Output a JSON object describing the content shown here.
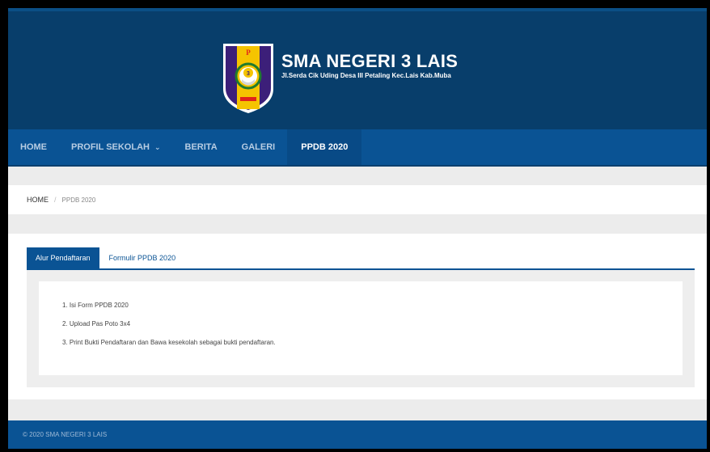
{
  "header": {
    "school_name": "SMA NEGERI 3 LAIS",
    "address": "Jl.Serda Cik Uding Desa III Petaling Kec.Lais Kab.Muba"
  },
  "nav": {
    "items": [
      {
        "label": "HOME"
      },
      {
        "label": "PROFIL SEKOLAH"
      },
      {
        "label": "BERITA"
      },
      {
        "label": "GALERI"
      },
      {
        "label": "PPDB 2020"
      }
    ],
    "active_label": "PPDB 2020"
  },
  "breadcrumb": {
    "home": "HOME",
    "separator": "/",
    "current": "PPDB 2020"
  },
  "tabs": {
    "items": [
      {
        "label": "Alur Pendaftaran"
      },
      {
        "label": "Formulir PPDB 2020"
      }
    ],
    "active_label": "Alur Pendaftaran"
  },
  "steps": [
    "1. Isi Form PPDB 2020",
    "2. Upload Pas Poto 3x4",
    "3. Print Bukti Pendaftaran dan Bawa kesekolah sebagai bukti pendaftaran."
  ],
  "footer": {
    "text": "© 2020 SMA NEGERI 3 LAIS"
  },
  "colors": {
    "header_bg": "#083e6b",
    "nav_bg": "#0a5394",
    "accent": "#0a5394"
  },
  "icons": {
    "logo": "school-crest-logo",
    "dropdown": "chevron-down-icon"
  }
}
